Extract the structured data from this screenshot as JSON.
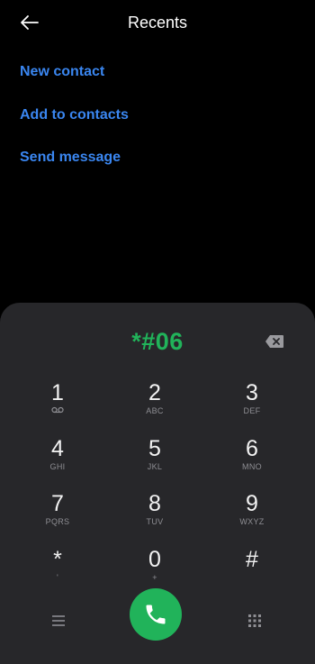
{
  "header": {
    "title": "Recents",
    "back_icon": "arrow-left-icon"
  },
  "options": [
    {
      "label": "New contact"
    },
    {
      "label": "Add to contacts"
    },
    {
      "label": "Send message"
    }
  ],
  "dialer": {
    "entered_number": "*#06",
    "keys": [
      {
        "digit": "1",
        "letters": ""
      },
      {
        "digit": "2",
        "letters": "ABC"
      },
      {
        "digit": "3",
        "letters": "DEF"
      },
      {
        "digit": "4",
        "letters": "GHI"
      },
      {
        "digit": "5",
        "letters": "JKL"
      },
      {
        "digit": "6",
        "letters": "MNO"
      },
      {
        "digit": "7",
        "letters": "PQRS"
      },
      {
        "digit": "8",
        "letters": "TUV"
      },
      {
        "digit": "9",
        "letters": "WXYZ"
      },
      {
        "digit": "*",
        "letters": "'"
      },
      {
        "digit": "0",
        "letters": "+"
      },
      {
        "digit": "#",
        "letters": ""
      }
    ],
    "icons": {
      "voicemail": "voicemail-icon",
      "backspace": "backspace-icon",
      "menu": "menu-icon",
      "call": "phone-icon",
      "keypad": "dialpad-grid-icon"
    }
  },
  "colors": {
    "background": "#000000",
    "panel": "#27272a",
    "accent_blue": "#3a86f0",
    "accent_green": "#21b35a",
    "subtext": "#8e8e93"
  }
}
